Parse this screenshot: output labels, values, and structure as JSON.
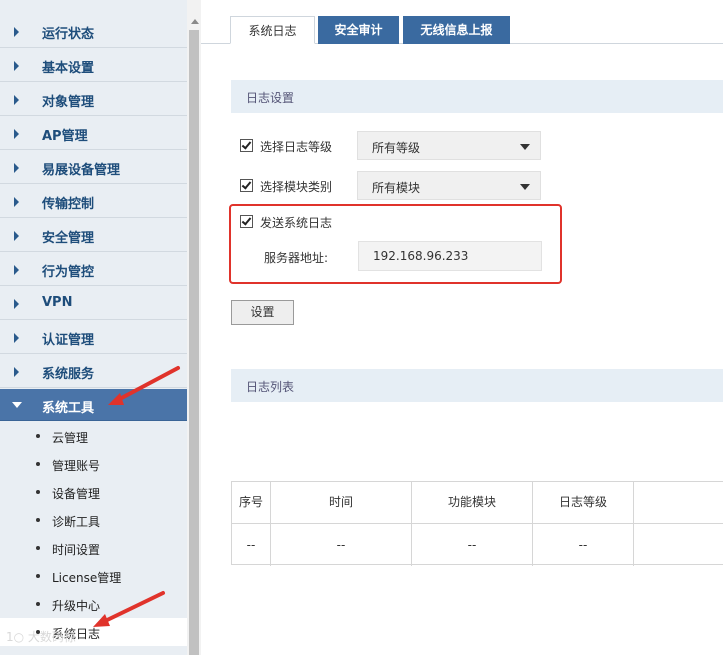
{
  "sidebar": {
    "items": [
      {
        "label": "运行状态"
      },
      {
        "label": "基本设置"
      },
      {
        "label": "对象管理"
      },
      {
        "label": "AP管理"
      },
      {
        "label": "易展设备管理"
      },
      {
        "label": "传输控制"
      },
      {
        "label": "安全管理"
      },
      {
        "label": "行为管控"
      },
      {
        "label": "VPN"
      },
      {
        "label": "认证管理"
      },
      {
        "label": "系统服务"
      },
      {
        "label": "系统工具",
        "expanded": true
      }
    ],
    "sub_items": [
      {
        "label": "云管理"
      },
      {
        "label": "管理账号"
      },
      {
        "label": "设备管理"
      },
      {
        "label": "诊断工具"
      },
      {
        "label": "时间设置"
      },
      {
        "label": "License管理"
      },
      {
        "label": "升级中心"
      },
      {
        "label": "系统日志",
        "selected": true
      }
    ]
  },
  "tabs": [
    {
      "label": "系统日志",
      "active": true
    },
    {
      "label": "安全审计",
      "active": false
    },
    {
      "label": "无线信息上报",
      "active": false
    }
  ],
  "log_settings": {
    "title": "日志设置",
    "level": {
      "label": "选择日志等级",
      "checked": true,
      "value": "所有等级"
    },
    "module": {
      "label": "选择模块类别",
      "checked": true,
      "value": "所有模块"
    },
    "send": {
      "label": "发送系统日志",
      "checked": true
    },
    "server": {
      "label": "服务器地址:",
      "value": "192.168.96.233"
    },
    "submit_label": "设置"
  },
  "log_list": {
    "title": "日志列表",
    "columns": [
      "序号",
      "时间",
      "功能模块",
      "日志等级"
    ],
    "rows": [
      [
        "--",
        "--",
        "--",
        "--"
      ]
    ]
  },
  "watermark": "1○ 大数码惊",
  "colors": {
    "accent": "#3a6aa0",
    "active_nav": "#4a74a8",
    "highlight": "#e0332b",
    "sidebar_bg": "#e9eef3",
    "section_bg": "#e6eef5"
  }
}
